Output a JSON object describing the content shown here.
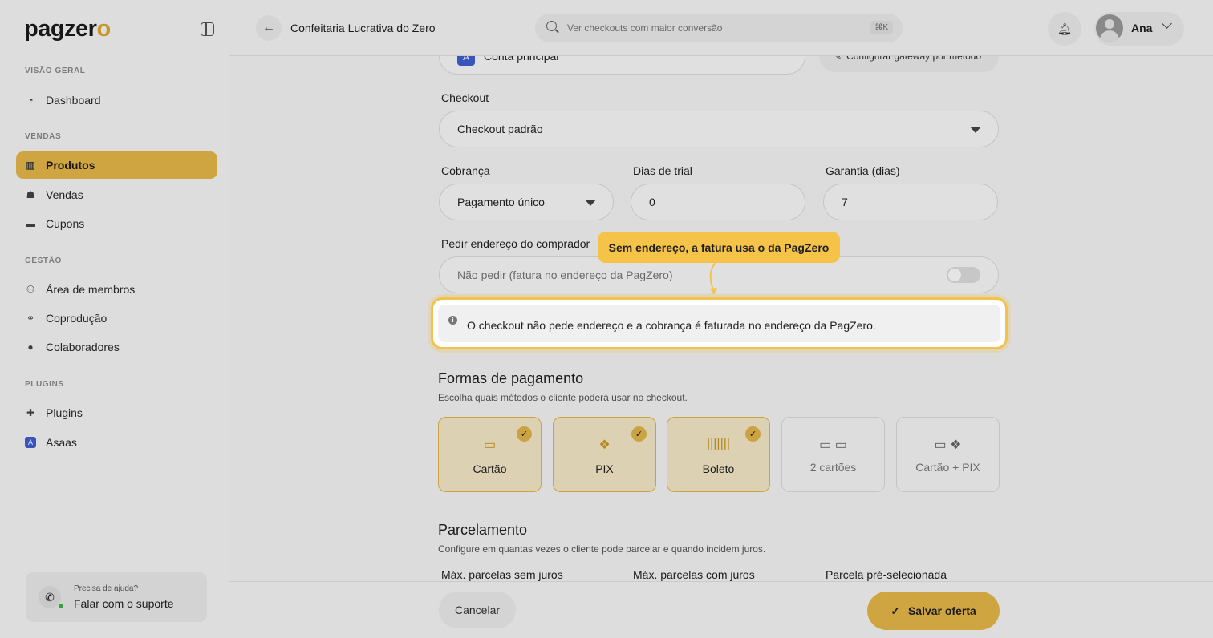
{
  "brand": {
    "name_prefix": "pagzer",
    "name_suffix": "o"
  },
  "sidebar": {
    "sections": [
      {
        "title": "VISÃO GERAL",
        "items": [
          {
            "label": "Dashboard",
            "icon": "dashboard-icon"
          }
        ]
      },
      {
        "title": "VENDAS",
        "items": [
          {
            "label": "Produtos",
            "icon": "box-icon",
            "active": true
          },
          {
            "label": "Vendas",
            "icon": "sales-icon"
          },
          {
            "label": "Cupons",
            "icon": "coupon-icon"
          }
        ]
      },
      {
        "title": "GESTÃO",
        "items": [
          {
            "label": "Área de membros",
            "icon": "members-icon"
          },
          {
            "label": "Coprodução",
            "icon": "handshake-icon"
          },
          {
            "label": "Colaboradores",
            "icon": "user-icon"
          }
        ]
      },
      {
        "title": "PLUGINS",
        "items": [
          {
            "label": "Plugins",
            "icon": "puzzle-icon"
          },
          {
            "label": "Asaas",
            "icon": "asaas-icon"
          }
        ]
      }
    ],
    "help": {
      "line1": "Precisa de ajuda?",
      "line2": "Falar com o suporte"
    }
  },
  "topbar": {
    "title": "Confeitaria Lucrativa do Zero",
    "search_placeholder": "Ver checkouts com maior conversão",
    "search_shortcut": "⌘K",
    "user_name": "Ana"
  },
  "form": {
    "account": {
      "value": "Conta principal"
    },
    "gateway_button": "Configurar gateway por método",
    "checkout": {
      "label": "Checkout",
      "value": "Checkout padrão"
    },
    "cobranca": {
      "label": "Cobrança",
      "value": "Pagamento único"
    },
    "trial": {
      "label": "Dias de trial",
      "value": "0"
    },
    "garantia": {
      "label": "Garantia (dias)",
      "value": "7"
    },
    "endereco": {
      "label": "Pedir endereço do comprador",
      "value": "Não pedir (fatura no endereço da PagZero)",
      "enabled": false
    },
    "info": "O checkout não pede endereço e a cobrança é faturada no endereço da PagZero."
  },
  "tooltip": "Sem endereço, a fatura usa o da PagZero",
  "payment": {
    "title": "Formas de pagamento",
    "desc": "Escolha quais métodos o cliente poderá usar no checkout.",
    "methods": [
      {
        "label": "Cartão",
        "icon": "card-icon",
        "selected": true
      },
      {
        "label": "PIX",
        "icon": "pix-icon",
        "selected": true
      },
      {
        "label": "Boleto",
        "icon": "barcode-icon",
        "selected": true
      },
      {
        "label": "2 cartões",
        "icon": "two-cards-icon",
        "selected": false
      },
      {
        "label": "Cartão + PIX",
        "icon": "card-pix-icon",
        "selected": false
      }
    ]
  },
  "parcelamento": {
    "title": "Parcelamento",
    "desc": "Configure em quantas vezes o cliente pode parcelar e quando incidem juros.",
    "cols": [
      "Máx. parcelas sem juros",
      "Máx. parcelas com juros",
      "Parcela pré-selecionada"
    ]
  },
  "footer": {
    "cancel": "Cancelar",
    "save": "Salvar oferta"
  },
  "colors": {
    "accent": "#e7b84a",
    "tooltip": "#f5c347",
    "asaas": "#3f5fd4"
  }
}
